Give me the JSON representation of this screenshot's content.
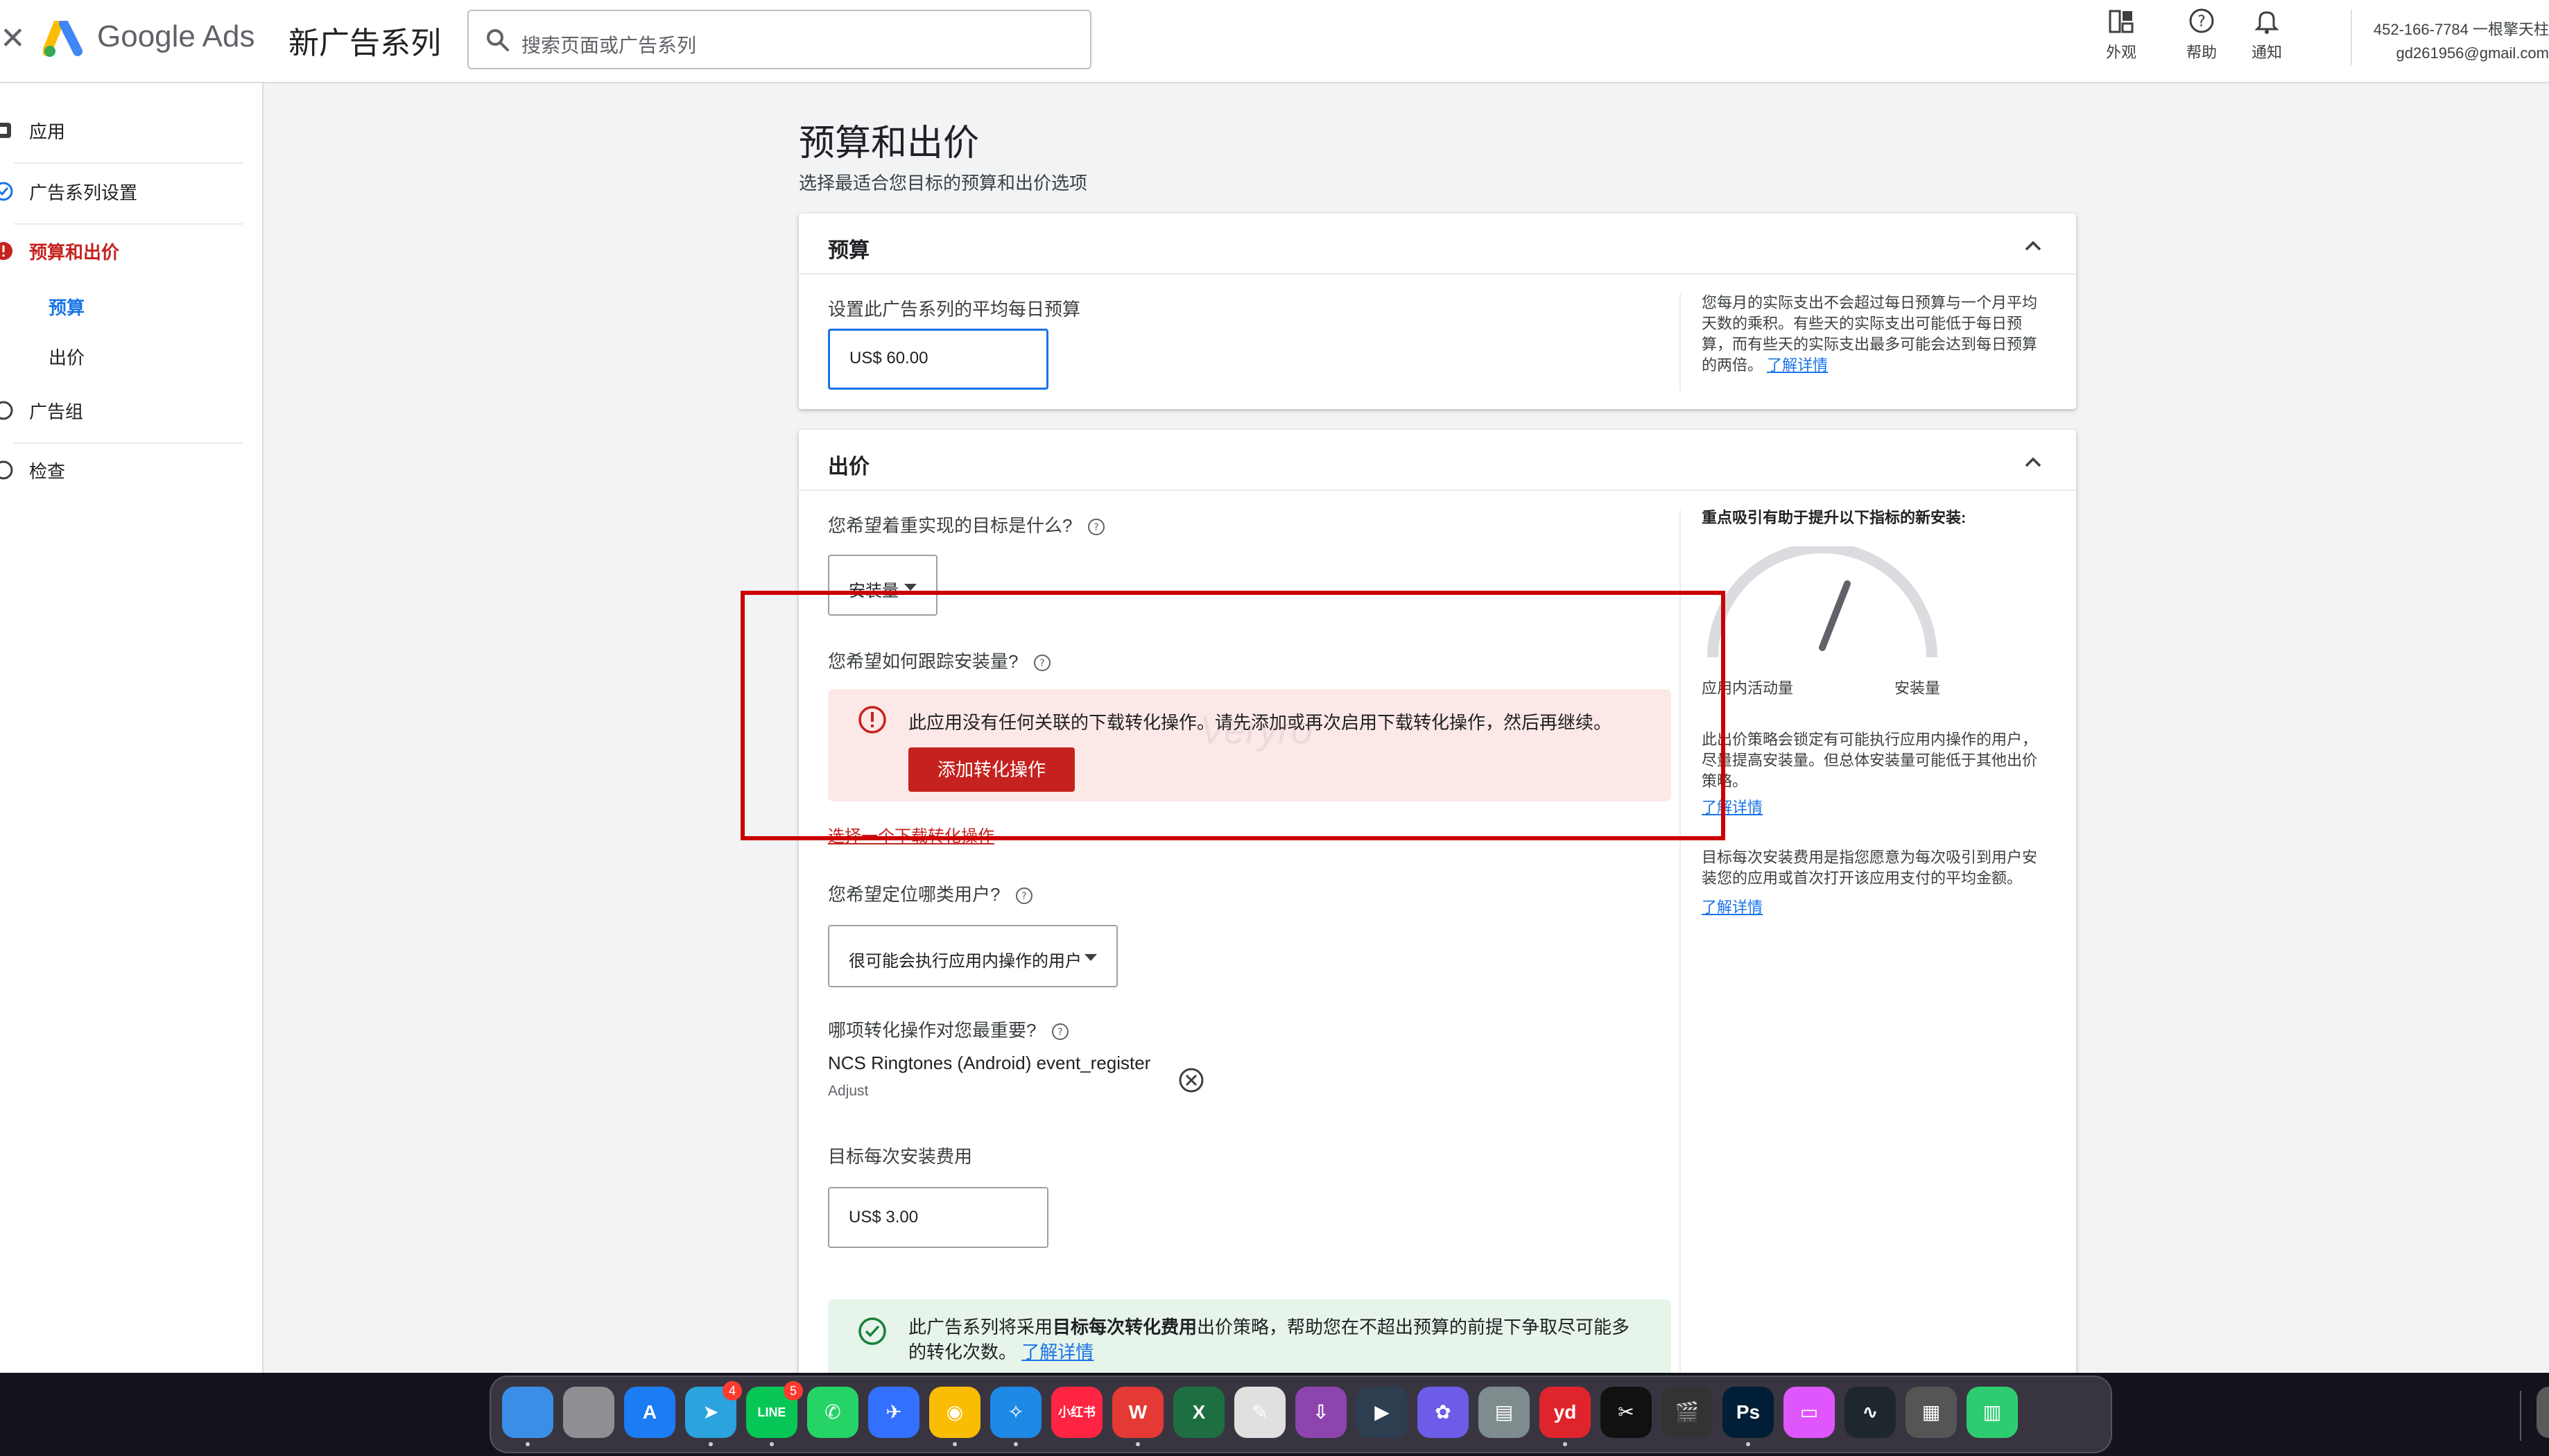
{
  "header": {
    "brand": "Google Ads",
    "campaign_title": "新广告系列",
    "search_placeholder": "搜索页面或广告系列",
    "buttons": [
      {
        "label": "外观",
        "icon": "appearance-icon"
      },
      {
        "label": "帮助",
        "icon": "help-icon"
      },
      {
        "label": "通知",
        "icon": "bell-icon"
      }
    ],
    "account_line1": "452-166-7784 一根擎天柱",
    "account_line2": "gd261956@gmail.com"
  },
  "sidebar": {
    "items": [
      {
        "label": "应用",
        "status": "app-icon"
      },
      {
        "label": "广告系列设置",
        "status": "check-circle-icon"
      },
      {
        "label": "预算和出价",
        "status": "error-icon",
        "active": true
      },
      {
        "label": "广告组",
        "status": "empty-circle-icon"
      },
      {
        "label": "检查",
        "status": "empty-circle-icon"
      }
    ],
    "subitems": [
      {
        "label": "预算",
        "active": true
      },
      {
        "label": "出价",
        "active": false
      }
    ]
  },
  "main": {
    "title": "预算和出价",
    "subtitle": "选择最适合您目标的预算和出价选项",
    "budget": {
      "header": "预算",
      "label": "设置此广告系列的平均每日预算",
      "value": "US$ 60.00",
      "note": "您每月的实际支出不会超过每日预算与一个月平均天数的乘积。有些天的实际支出可能低于每日预算，而有些天的实际支出最多可能会达到每日预算的两倍。",
      "note_link": "了解详情"
    },
    "bidding": {
      "header": "出价",
      "q_goal": "您希望着重实现的目标是什么?",
      "goal_value": "安装量",
      "q_track": "您希望如何跟踪安装量?",
      "error_msg": "此应用没有任何关联的下载转化操作。请先添加或再次启用下载转化操作，然后再继续。",
      "error_button": "添加转化操作",
      "select_link": "选择一个下载转化操作",
      "q_users": "您希望定位哪类用户?",
      "users_value": "很可能会执行应用内操作的用户",
      "q_conversion": "哪项转化操作对您最重要?",
      "conversion_name": "NCS Ringtones (Android) event_register",
      "conversion_source": "Adjust",
      "target_label": "目标每次安装费用",
      "target_value": "US$ 3.00",
      "success_pre": "此广告系列将采用",
      "success_bold": "目标每次转化费用",
      "success_post": "出价策略，帮助您在不超出预算的前提下争取尽可能多的转化次数。",
      "success_link": "了解详情",
      "side_title": "重点吸引有助于提升以下指标的新安装:",
      "gauge_left": "应用内活动量",
      "gauge_right": "安装量",
      "side_note1": "此出价策略会锁定有可能执行应用内操作的用户，尽量提高安装量。但总体安装量可能低于其他出价策略。",
      "side_link1": "了解详情",
      "side_note2": "目标每次安装费用是指您愿意为每次吸引到用户安装您的应用或首次打开该应用支付的平均金额。",
      "side_link2": "了解详情"
    }
  },
  "watermark": "Veryro",
  "dock": {
    "apps": [
      {
        "name": "finder",
        "color": "#3a8ee6",
        "glyph": ""
      },
      {
        "name": "launchpad",
        "color": "#8e8e93",
        "glyph": ""
      },
      {
        "name": "app-store",
        "color": "#1c7cf4",
        "glyph": "A"
      },
      {
        "name": "telegram",
        "color": "#2aa3de",
        "glyph": "➤",
        "badge": "4"
      },
      {
        "name": "line",
        "color": "#06c755",
        "glyph": "LINE",
        "badge": "5"
      },
      {
        "name": "whatsapp",
        "color": "#25d366",
        "glyph": "✆"
      },
      {
        "name": "feishu",
        "color": "#3370ff",
        "glyph": "✈"
      },
      {
        "name": "chrome",
        "color": "#fbbc04",
        "glyph": "◉"
      },
      {
        "name": "safari",
        "color": "#1e88e5",
        "glyph": "✧"
      },
      {
        "name": "xiaohongshu",
        "color": "#ff2442",
        "glyph": "小红书"
      },
      {
        "name": "wps",
        "color": "#e53935",
        "glyph": "W"
      },
      {
        "name": "excel",
        "color": "#1d6f42",
        "glyph": "X"
      },
      {
        "name": "textedit",
        "color": "#e0e0e0",
        "glyph": "✎"
      },
      {
        "name": "downloader",
        "color": "#8e44ad",
        "glyph": "⇩"
      },
      {
        "name": "infuse",
        "color": "#2c3e50",
        "glyph": "▶"
      },
      {
        "name": "pixelmator",
        "color": "#6c5ce7",
        "glyph": "✿"
      },
      {
        "name": "preview",
        "color": "#7f8c8d",
        "glyph": "▤"
      },
      {
        "name": "youdao",
        "color": "#e0242c",
        "glyph": "yd"
      },
      {
        "name": "capcut",
        "color": "#111111",
        "glyph": "✂"
      },
      {
        "name": "final-cut",
        "color": "#333333",
        "glyph": "🎬"
      },
      {
        "name": "photoshop",
        "color": "#001e36",
        "glyph": "Ps"
      },
      {
        "name": "screen-sharing",
        "color": "#e056fd",
        "glyph": "▭"
      },
      {
        "name": "activity-monitor",
        "color": "#1e272e",
        "glyph": "∿"
      },
      {
        "name": "calculator",
        "color": "#555555",
        "glyph": "▦"
      },
      {
        "name": "numbers",
        "color": "#2ecc71",
        "glyph": "▥"
      },
      {
        "name": "trash",
        "color": "#5a5a5a",
        "glyph": "🗑"
      }
    ]
  },
  "colors": {
    "accent": "#1a73e8",
    "error": "#c5221f",
    "error_bg": "#fce8e6",
    "success_bg": "#e6f4ea",
    "highlight": "#cc0000"
  }
}
